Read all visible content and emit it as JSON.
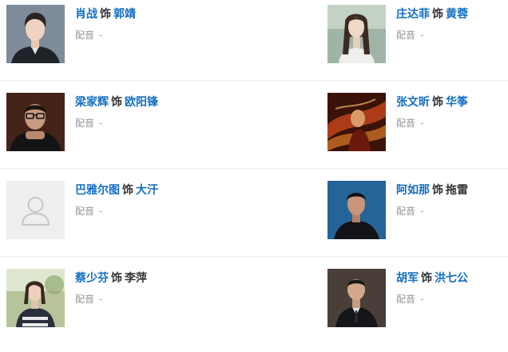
{
  "cast": [
    {
      "actor": "肖战",
      "as": "饰",
      "role": "郭靖",
      "role_linked": true,
      "dub_label": "配音",
      "dub_value": "-",
      "photo": "portrait-dark-suit"
    },
    {
      "actor": "庄达菲",
      "as": "饰",
      "role": "黄蓉",
      "role_linked": true,
      "dub_label": "配音",
      "dub_value": "-",
      "photo": "portrait-long-hair"
    },
    {
      "actor": "梁家辉",
      "as": "饰",
      "role": "欧阳锋",
      "role_linked": true,
      "dub_label": "配音",
      "dub_value": "-",
      "photo": "portrait-glasses"
    },
    {
      "actor": "张文昕",
      "as": "饰",
      "role": "华筝",
      "role_linked": true,
      "dub_label": "配音",
      "dub_value": "-",
      "photo": "portrait-motion-red"
    },
    {
      "actor": "巴雅尔图",
      "as": "饰",
      "role": "大汗",
      "role_linked": true,
      "dub_label": "配音",
      "dub_value": "-",
      "photo": "placeholder-avatar"
    },
    {
      "actor": "阿如那",
      "as": "饰",
      "role": "拖雷",
      "role_linked": false,
      "dub_label": "配音",
      "dub_value": "-",
      "photo": "portrait-blue-bg"
    },
    {
      "actor": "蔡少芬",
      "as": "饰",
      "role": "李萍",
      "role_linked": false,
      "dub_label": "配音",
      "dub_value": "-",
      "photo": "portrait-outdoor"
    },
    {
      "actor": "胡军",
      "as": "饰",
      "role": "洪七公",
      "role_linked": true,
      "dub_label": "配音",
      "dub_value": "-",
      "photo": "portrait-dark-suit-tie"
    }
  ],
  "colors": {
    "link": "#136ec2",
    "text": "#333333",
    "muted": "#999999",
    "divider": "#ececec"
  }
}
